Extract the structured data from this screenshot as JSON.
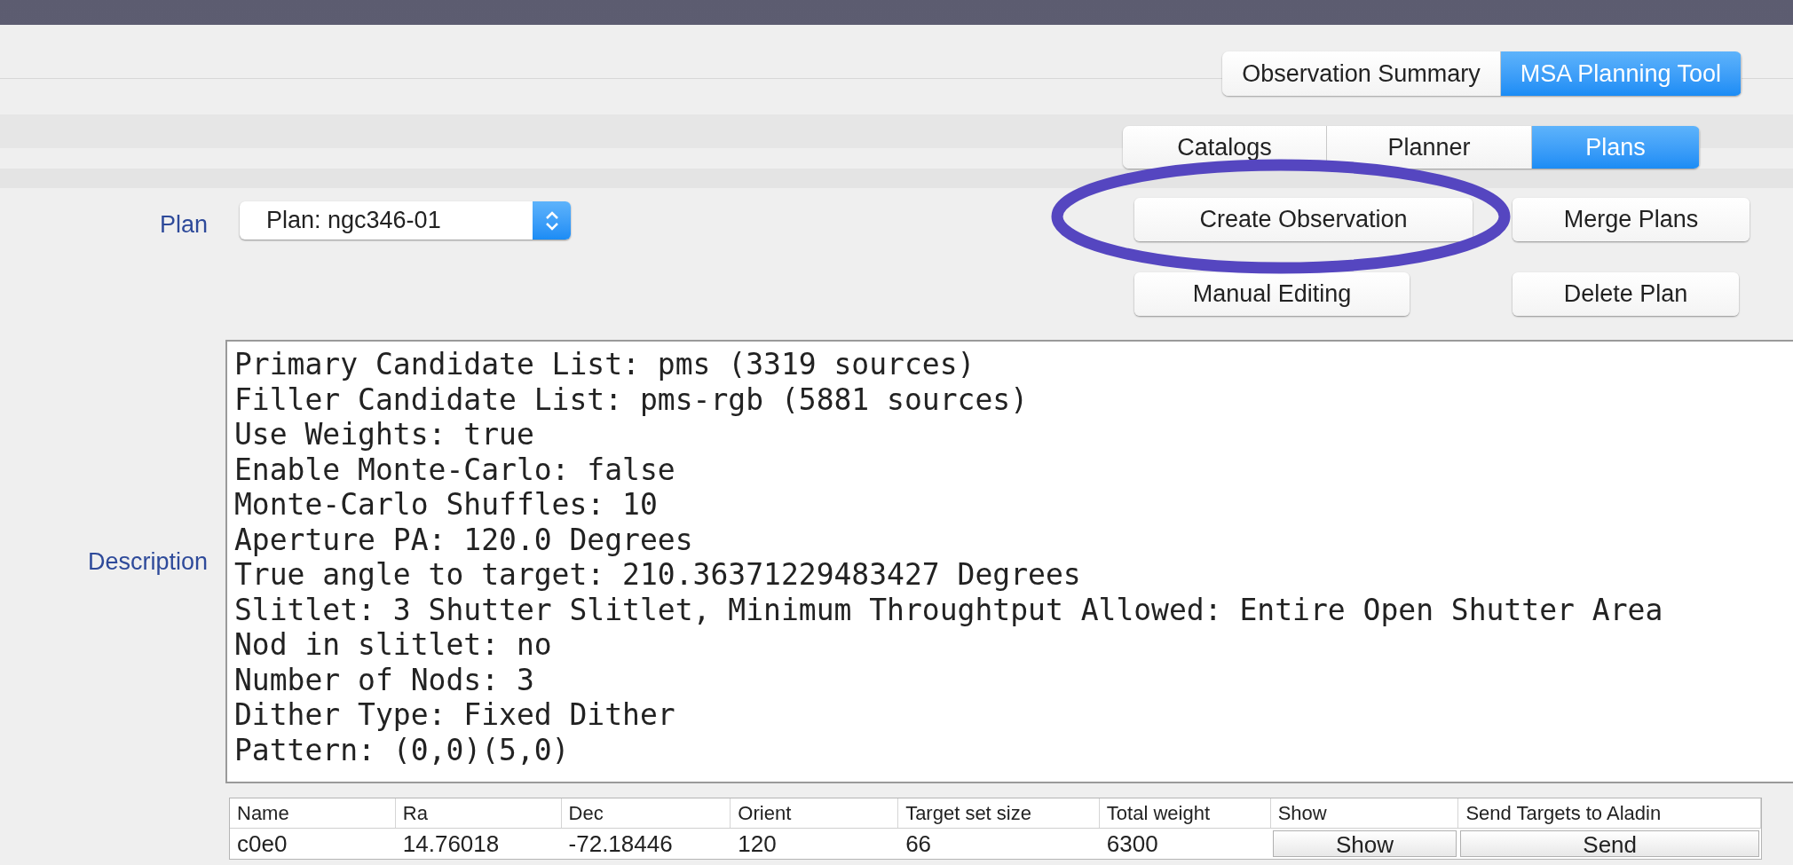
{
  "main_tabs": [
    {
      "label": "Observation Summary",
      "selected": false
    },
    {
      "label": "MSA Planning Tool",
      "selected": true
    }
  ],
  "sub_tabs": [
    {
      "label": "Catalogs",
      "selected": false
    },
    {
      "label": "Planner",
      "selected": false
    },
    {
      "label": "Plans",
      "selected": true
    }
  ],
  "plan": {
    "label": "Plan",
    "value": "Plan: ngc346-01"
  },
  "buttons": [
    "Create Observation",
    "Merge Plans",
    "Manual Editing",
    "Delete Plan"
  ],
  "description": {
    "label": "Description",
    "lines": [
      "Primary Candidate List: pms (3319 sources)",
      "Filler Candidate List: pms-rgb (5881 sources)",
      "Use Weights: true",
      "Enable Monte-Carlo: false",
      "Monte-Carlo Shuffles: 10",
      "Aperture PA: 120.0 Degrees",
      "True angle to target: 210.36371229483427 Degrees",
      "Slitlet: 3 Shutter Slitlet, Minimum Throughtput Allowed: Entire Open Shutter Area",
      "Nod in slitlet: no",
      "Number of Nods: 3",
      "Dither Type: Fixed Dither",
      "Pattern: (0,0)(5,0)"
    ]
  },
  "table": {
    "columns": [
      "Name",
      "Ra",
      "Dec",
      "Orient",
      "Target set size",
      "Total weight",
      "Show",
      "Send Targets to Aladin"
    ],
    "rows": [
      [
        {
          "kind": "text",
          "text": "c0e0"
        },
        {
          "kind": "text",
          "text": "14.76018"
        },
        {
          "kind": "text",
          "text": "-72.18446"
        },
        {
          "kind": "text",
          "text": "120"
        },
        {
          "kind": "text",
          "text": "66"
        },
        {
          "kind": "text",
          "text": "6300"
        },
        {
          "kind": "button",
          "text": "Show"
        },
        {
          "kind": "button",
          "text": "Send"
        }
      ]
    ]
  }
}
